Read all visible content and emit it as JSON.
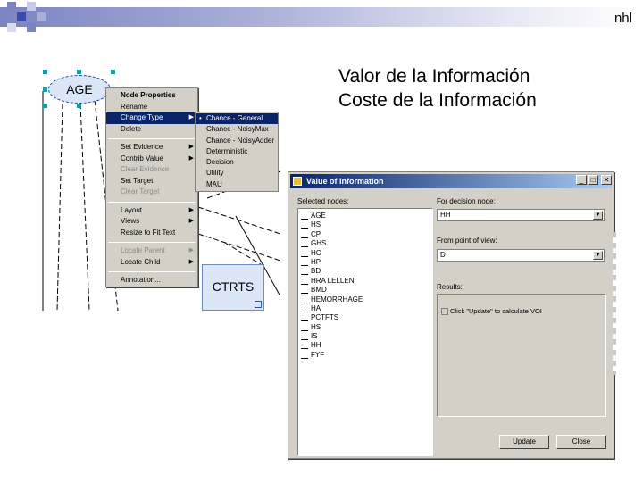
{
  "corner_label": "nhl",
  "headings": [
    "Valor de la Información",
    "Coste de la Información"
  ],
  "colors": {
    "accent": "#0a246a",
    "node_fill": "#dbe7f6",
    "menu_bg": "#d4d0c8",
    "band": "#7b84c2"
  },
  "canvas": {
    "node_age": "AGE",
    "node_ctrts": "CTRTS"
  },
  "context_menu": {
    "items": [
      "Node Properties",
      "Rename",
      "Change Type",
      "Delete",
      "Set Evidence",
      "Contrib Value",
      "Clear Evidence",
      "Set Target",
      "Clear Target",
      "Layout",
      "Views",
      "Resize to Fit Text",
      "Locate Parent",
      "Locate Child",
      "Annotation..."
    ]
  },
  "sub_menu": {
    "items": [
      "Chance - General",
      "Chance - NoisyMax",
      "Chance - NoisyAdder",
      "Deterministic",
      "Decision",
      "Utility",
      "MAU"
    ]
  },
  "dialog": {
    "title": "Value of Information",
    "close_icon_glyph": "✕",
    "min_icon_glyph": "_",
    "max_icon_glyph": "□",
    "selected_nodes_label": "Selected nodes:",
    "nodes": [
      "AGE",
      "HS",
      "CP",
      "GHS",
      "HC",
      "HP",
      "BD",
      "HRA LELLEN",
      "BMD",
      "HEMORRHAGE",
      "HA",
      "PCTFTS",
      "HS",
      "IS",
      "HH",
      "FYF"
    ],
    "decision_label": "For decision node:",
    "decision_value": "HH",
    "point_of_view_label": "From point of view:",
    "point_of_view_value": "D",
    "results_label": "Results:",
    "results_row": "Click \"Update\" to calculate VOI",
    "update_button": "Update",
    "close_button": "Close",
    "dropdown_glyph": "▼"
  }
}
